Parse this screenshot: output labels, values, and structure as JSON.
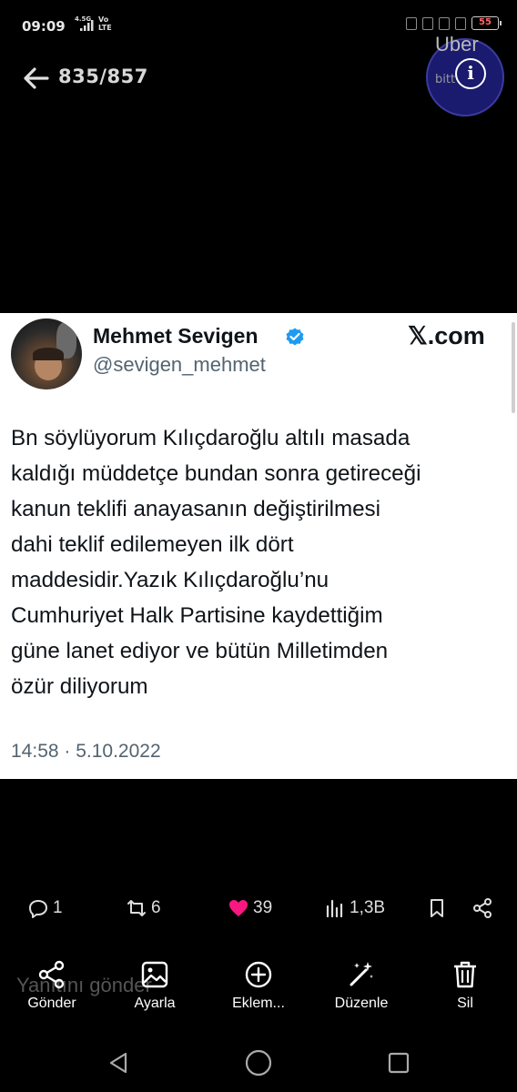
{
  "status_bar": {
    "time": "09:09",
    "network": "4.5G",
    "volte_top": "Vo",
    "volte_bottom": "LTE",
    "battery": "55"
  },
  "viewer": {
    "counter": "835/857",
    "overlay_brand": "Uber",
    "overlay_sub": "bitt"
  },
  "tweet": {
    "author_name": "Mehmet Sevigen",
    "author_handle": "@sevigen_mehmet",
    "site": "𝕏.com",
    "lines": [
      "Bn söylüyorum Kılıçdaroğlu altılı masada",
      "kaldığı müddetçe bundan sonra getireceği",
      "kanun teklifi anayasanın değiştirilmesi",
      "dahi teklif edilemeyen ilk dört",
      "maddesidir.Yazık  Kılıçdaroğlu’nu",
      "Cumhuriyet Halk Partisine kaydettiğim",
      "güne lanet ediyor ve bütün Milletimden",
      "özür diliyorum"
    ],
    "timestamp": "14:58 · 5.10.2022"
  },
  "engagement": {
    "replies": "1",
    "retweets": "6",
    "likes": "39",
    "views": "1,3B",
    "like_color": "#f91880"
  },
  "reply_placeholder": "Yanıtını gönder",
  "actions": [
    {
      "label": "Gönder",
      "icon": "share-icon"
    },
    {
      "label": "Ayarla",
      "icon": "adjust-image-icon"
    },
    {
      "label": "Eklem...",
      "icon": "add-icon"
    },
    {
      "label": "Düzenle",
      "icon": "magic-wand-icon"
    },
    {
      "label": "Sil",
      "icon": "trash-icon"
    }
  ],
  "navigation": [
    "back-icon",
    "home-icon",
    "recents-icon"
  ]
}
